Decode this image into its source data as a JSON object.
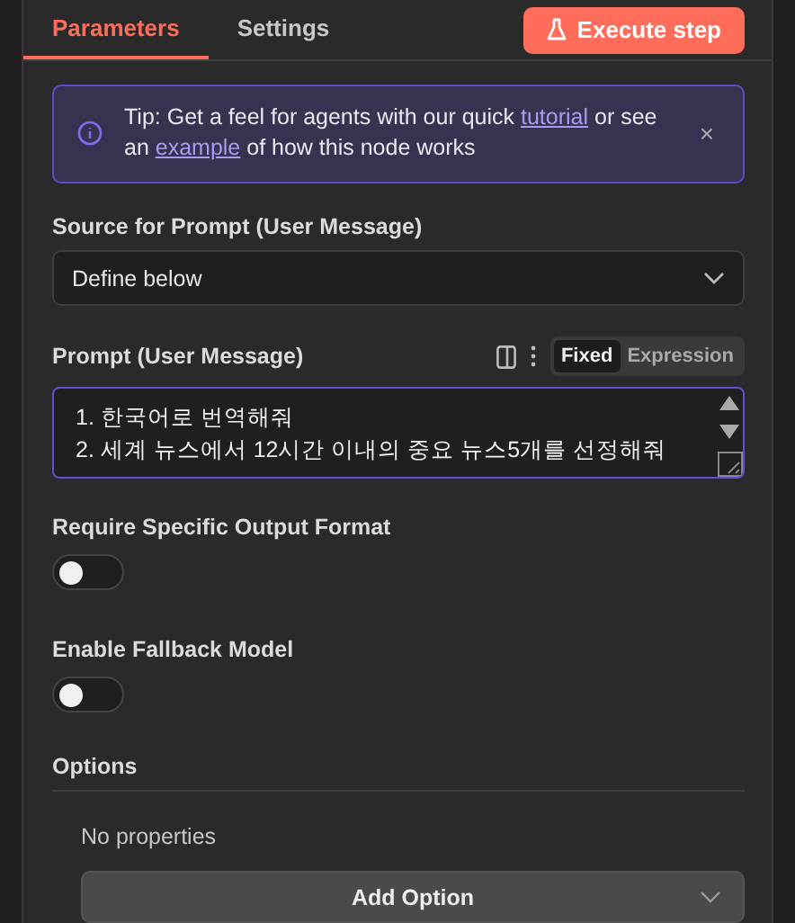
{
  "tabs": [
    {
      "label": "Parameters",
      "selected": true
    },
    {
      "label": "Settings",
      "selected": false
    }
  ],
  "execute_button": {
    "label": "Execute step"
  },
  "tip": {
    "text": "Tip: Get a feel for agents with our quick",
    "link1": "tutorial",
    "middle": "or see an",
    "link2": "example",
    "end": "of how this node works",
    "close": "×"
  },
  "source_field": {
    "label": "Source for Prompt (User Message)",
    "value": "Define below"
  },
  "prompt_field": {
    "label": "Prompt (User Message)",
    "modes": [
      {
        "label": "Fixed",
        "selected": true
      },
      {
        "label": "Expression",
        "selected": false
      }
    ],
    "lines": [
      "1. 한국어로 번역해줘",
      "2. 세계 뉴스에서 12시간 이내의 중요 뉴스5개를 선정해줘"
    ]
  },
  "toggles": [
    {
      "label": "Require Specific Output Format",
      "on": false
    },
    {
      "label": "Enable Fallback Model",
      "on": false
    }
  ],
  "options": {
    "title": "Options",
    "empty_text": "No properties",
    "add_button": "Add Option"
  }
}
